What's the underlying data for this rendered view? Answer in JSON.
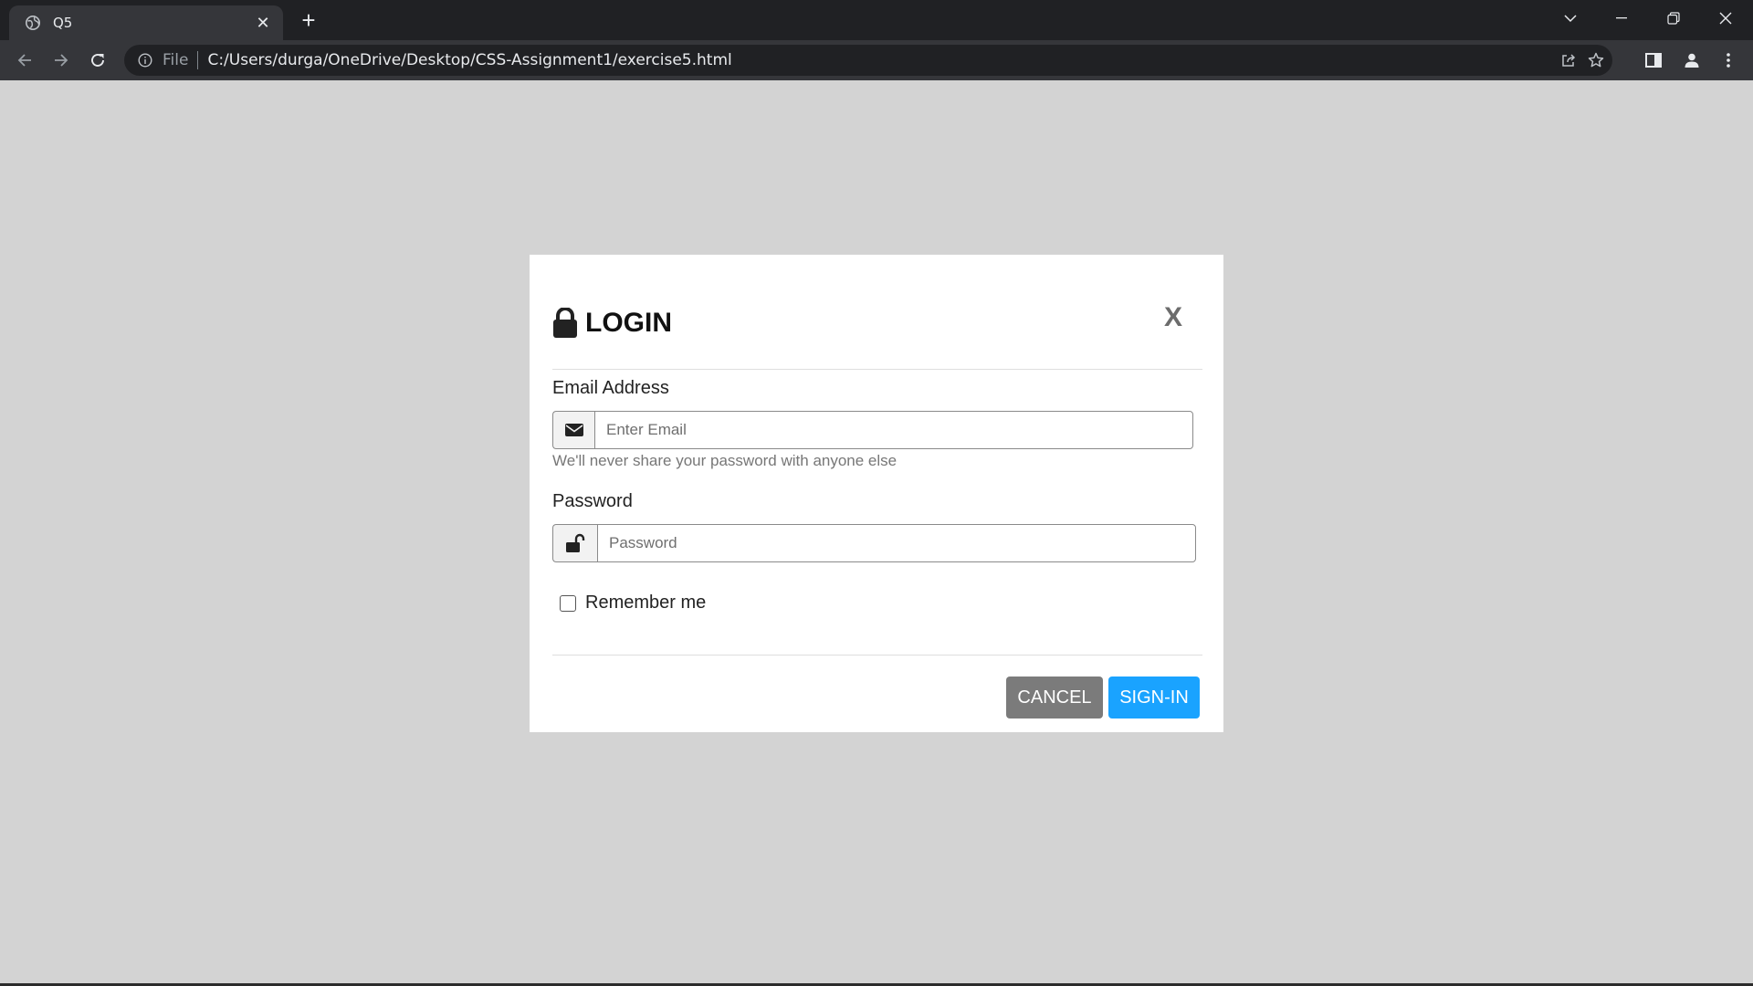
{
  "browser": {
    "tab_title": "Q5",
    "tab_close": "✕",
    "new_tab": "+",
    "address_scheme": "File",
    "address_url": "C:/Users/durga/OneDrive/Desktop/CSS-Assignment1/exercise5.html"
  },
  "modal": {
    "title": "LOGIN",
    "close_label": "X",
    "email": {
      "label": "Email Address",
      "placeholder": "Enter Email",
      "help": "We'll never share your password with anyone else"
    },
    "password": {
      "label": "Password",
      "placeholder": "Password"
    },
    "remember_label": "Remember me",
    "cancel_label": "CANCEL",
    "signin_label": "SIGN-IN"
  },
  "colors": {
    "page_background": "#d3d3d3",
    "cancel_button": "#7b7b7b",
    "signin_button": "#1aa3ff"
  },
  "icons": [
    "globe-icon",
    "back-icon",
    "forward-icon",
    "reload-icon",
    "info-icon",
    "share-icon",
    "star-icon",
    "side-panel-icon",
    "profile-icon",
    "menu-icon",
    "lock-icon",
    "envelope-icon",
    "unlock-icon"
  ]
}
